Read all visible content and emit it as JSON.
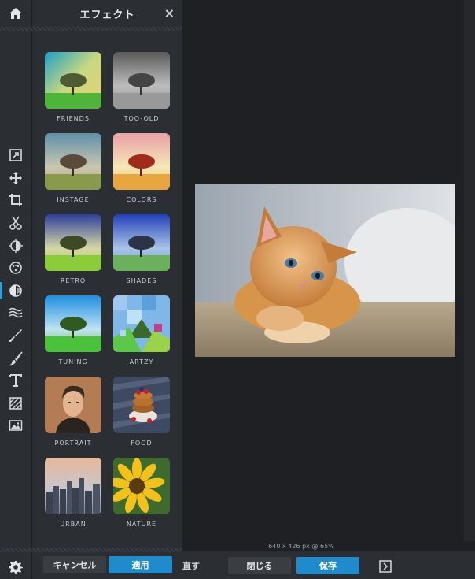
{
  "panel": {
    "title": "エフェクト",
    "close_label": "×",
    "cancel_label": "キャンセル",
    "apply_label": "適用"
  },
  "effects": [
    {
      "label": "FRIENDS"
    },
    {
      "label": "TOO-OLD"
    },
    {
      "label": "INSTAGE"
    },
    {
      "label": "COLORS"
    },
    {
      "label": "RETRO"
    },
    {
      "label": "SHADES"
    },
    {
      "label": "TUNING"
    },
    {
      "label": "ARTZY"
    },
    {
      "label": "PORTRAIT"
    },
    {
      "label": "FOOD"
    },
    {
      "label": "URBAN"
    },
    {
      "label": "NATURE"
    }
  ],
  "tools": [
    {
      "name": "resize-icon"
    },
    {
      "name": "move-icon"
    },
    {
      "name": "crop-icon"
    },
    {
      "name": "cut-icon"
    },
    {
      "name": "adjust-icon"
    },
    {
      "name": "filter-icon"
    },
    {
      "name": "effects-icon",
      "active": true
    },
    {
      "name": "wave-icon"
    },
    {
      "name": "brush-icon"
    },
    {
      "name": "paint-icon"
    },
    {
      "name": "text-icon"
    },
    {
      "name": "texture-icon"
    },
    {
      "name": "image-icon"
    }
  ],
  "canvas": {
    "status": "640 x 426 px @ 65%"
  },
  "bottombar": {
    "redo_text": "直す",
    "close_label": "閉じる",
    "save_label": "保存"
  },
  "colors": {
    "accent": "#1f8bcc",
    "panel_bg": "#2b2e33",
    "canvas_bg": "#1e2024"
  }
}
